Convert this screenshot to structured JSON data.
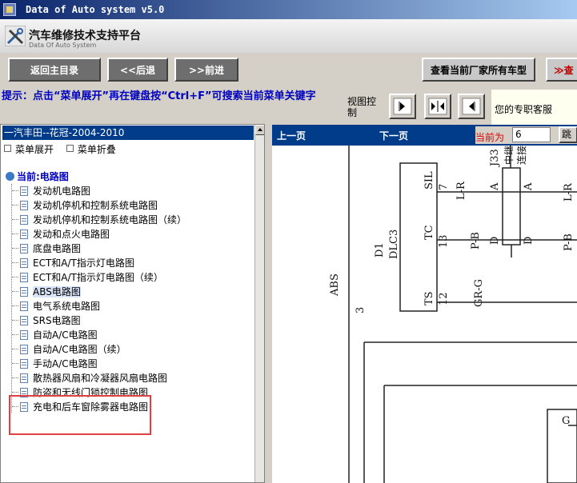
{
  "window": {
    "title": "Data of Auto system v5.0"
  },
  "header": {
    "app_name": "汽车维修技术支持平台",
    "app_sub": "Data Of Auto System"
  },
  "nav": {
    "home": "返回主目录",
    "back": "<<后退",
    "forward": ">>前进",
    "all_models": "查看当前厂家所有车型",
    "more": "≫查"
  },
  "hint": {
    "text": "提示：点击“菜单展开”再在键盘按“Ctrl+F”可搜索当前菜单关键字"
  },
  "view_control": {
    "label": "视图控制"
  },
  "service": {
    "label": "您的专职客服"
  },
  "sidebar": {
    "vehicle": "一汽丰田--花冠-2004-2010",
    "expand": "菜单展开",
    "collapse": "菜单折叠",
    "current": "当前:电路图",
    "items": [
      {
        "label": "发动机电路图"
      },
      {
        "label": "发动机停机和控制系统电路图"
      },
      {
        "label": "发动机停机和控制系统电路图（续）"
      },
      {
        "label": "发动和点火电路图"
      },
      {
        "label": "底盘电路图"
      },
      {
        "label": "ECT和A/T指示灯电路图"
      },
      {
        "label": "ECT和A/T指示灯电路图（续）"
      },
      {
        "label": "ABS电路图"
      },
      {
        "label": "电气系统电路图"
      },
      {
        "label": "SRS电路图"
      },
      {
        "label": "自动A/C电路图"
      },
      {
        "label": "自动A/C电路图（续）"
      },
      {
        "label": "手动A/C电路图"
      },
      {
        "label": "散热器风扇和冷凝器风扇电路图"
      },
      {
        "label": "防盗和无线门锁控制电路图"
      },
      {
        "label": "充电和后车窗除雾器电路图"
      }
    ],
    "selected_index": 7
  },
  "pager": {
    "prev": "上一页",
    "next": "下一页",
    "current_label": "当前为",
    "current_value": "6",
    "go": "跳转"
  },
  "diagram": {
    "labels": {
      "abs": "ABS",
      "num3": "3",
      "d1": "D1",
      "dlc3": "DLC3",
      "sil": "SIL",
      "tc": "TC",
      "ts": "TS",
      "p7": "7",
      "p13": "13",
      "p12": "12",
      "lr": "L-R",
      "pb": "P-B",
      "grg": "GR-G",
      "a1": "A",
      "a2": "A",
      "d1b": "D",
      "d2b": "D",
      "j33": "J33",
      "zhong": "中继",
      "lianjie": "连接",
      "lr2": "L-R",
      "pb2": "P-B",
      "g": "G"
    }
  }
}
